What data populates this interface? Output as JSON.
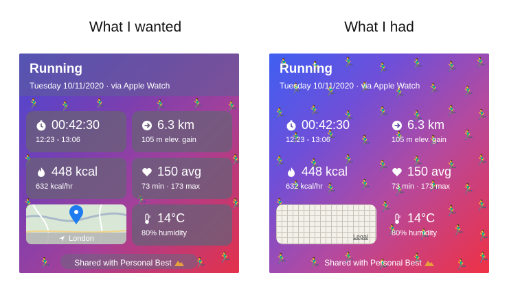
{
  "labels": {
    "wanted": "What I wanted",
    "had": "What I had"
  },
  "card": {
    "title": "Running",
    "subtitle": "Tuesday 10/11/2020 · via Apple Watch",
    "duration": "00:42:30",
    "time_range": "12:23 - 13:06",
    "distance": "6.3 km",
    "elevation": "105 m elev. gain",
    "calories": "448 kcal",
    "calorie_rate": "632 kcal/hr",
    "heart_rate": "150 avg",
    "heart_detail": "73 min · 173 max",
    "temperature": "14°C",
    "humidity": "80% humidity",
    "map_location": "London",
    "map_legal": "Legal",
    "shared": "Shared with Personal Best"
  },
  "icons": {
    "timer": "stopwatch-icon",
    "distance": "arrow-right-circle-icon",
    "calories": "flame-icon",
    "heart": "heart-icon",
    "temperature": "thermometer-icon",
    "location": "location-arrow-icon",
    "pin": "map-pin-icon",
    "runner": "runner-emoji-icon",
    "mountain": "mountain-icon"
  },
  "colors": {
    "left_gradient": [
      "#4a47d6",
      "#e4314a"
    ],
    "right_gradient": [
      "#3f5ff2",
      "#ef3145"
    ],
    "map_pin": "#1e7bf0"
  }
}
